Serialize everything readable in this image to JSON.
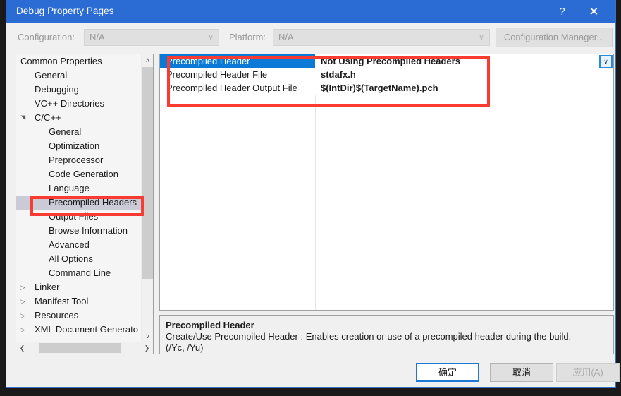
{
  "window": {
    "title": "Debug Property Pages",
    "help_icon": "?",
    "close_icon": "✕"
  },
  "config_bar": {
    "configuration_label": "Configuration:",
    "configuration_value": "N/A",
    "platform_label": "Platform:",
    "platform_value": "N/A",
    "config_manager_label": "Configuration Manager...",
    "caret_icon": "∨"
  },
  "tree": {
    "nodes": [
      {
        "label": "Common Properties",
        "indent": 0,
        "arrow": "",
        "selected": false
      },
      {
        "label": "General",
        "indent": 20,
        "arrow": "",
        "selected": false
      },
      {
        "label": "Debugging",
        "indent": 20,
        "arrow": "",
        "selected": false
      },
      {
        "label": "VC++ Directories",
        "indent": 20,
        "arrow": "",
        "selected": false
      },
      {
        "label": "C/C++",
        "indent": 20,
        "arrow": "expanded",
        "selected": false
      },
      {
        "label": "General",
        "indent": 40,
        "arrow": "",
        "selected": false
      },
      {
        "label": "Optimization",
        "indent": 40,
        "arrow": "",
        "selected": false
      },
      {
        "label": "Preprocessor",
        "indent": 40,
        "arrow": "",
        "selected": false
      },
      {
        "label": "Code Generation",
        "indent": 40,
        "arrow": "",
        "selected": false
      },
      {
        "label": "Language",
        "indent": 40,
        "arrow": "",
        "selected": false
      },
      {
        "label": "Precompiled Headers",
        "indent": 40,
        "arrow": "",
        "selected": true
      },
      {
        "label": "Output Files",
        "indent": 40,
        "arrow": "",
        "selected": false
      },
      {
        "label": "Browse Information",
        "indent": 40,
        "arrow": "",
        "selected": false
      },
      {
        "label": "Advanced",
        "indent": 40,
        "arrow": "",
        "selected": false
      },
      {
        "label": "All Options",
        "indent": 40,
        "arrow": "",
        "selected": false
      },
      {
        "label": "Command Line",
        "indent": 40,
        "arrow": "",
        "selected": false
      },
      {
        "label": "Linker",
        "indent": 20,
        "arrow": "collapsed",
        "selected": false
      },
      {
        "label": "Manifest Tool",
        "indent": 20,
        "arrow": "collapsed",
        "selected": false
      },
      {
        "label": "Resources",
        "indent": 20,
        "arrow": "collapsed",
        "selected": false
      },
      {
        "label": "XML Document Generato",
        "indent": 20,
        "arrow": "collapsed",
        "selected": false
      }
    ],
    "scroll_up_icon": "∧",
    "scroll_down_icon": "∨",
    "scroll_left_icon": "❮",
    "scroll_right_icon": "❯",
    "arrow_expanded_icon": "◢",
    "arrow_collapsed_icon": "▷"
  },
  "grid": {
    "rows": [
      {
        "name": "Precompiled Header",
        "value": "Not Using Precompiled Headers",
        "selected": true
      },
      {
        "name": "Precompiled Header File",
        "value": "stdafx.h",
        "selected": false
      },
      {
        "name": "Precompiled Header Output File",
        "value": "$(IntDir)$(TargetName).pch",
        "selected": false
      }
    ],
    "dropdown_icon": "∨"
  },
  "description": {
    "title": "Precompiled Header",
    "line1": "Create/Use Precompiled Header : Enables creation or use of a precompiled header during the build.",
    "line2": "(/Yc, /Yu)"
  },
  "buttons": {
    "ok": "确定",
    "cancel": "取消",
    "apply": "应用(A)"
  },
  "colors": {
    "titlebar": "#2b6bd4",
    "selection": "#0a7ad6",
    "tree_selection": "#cbcbd8",
    "annotation": "#fa3b32",
    "dialog_bg": "#f0f0f0"
  }
}
